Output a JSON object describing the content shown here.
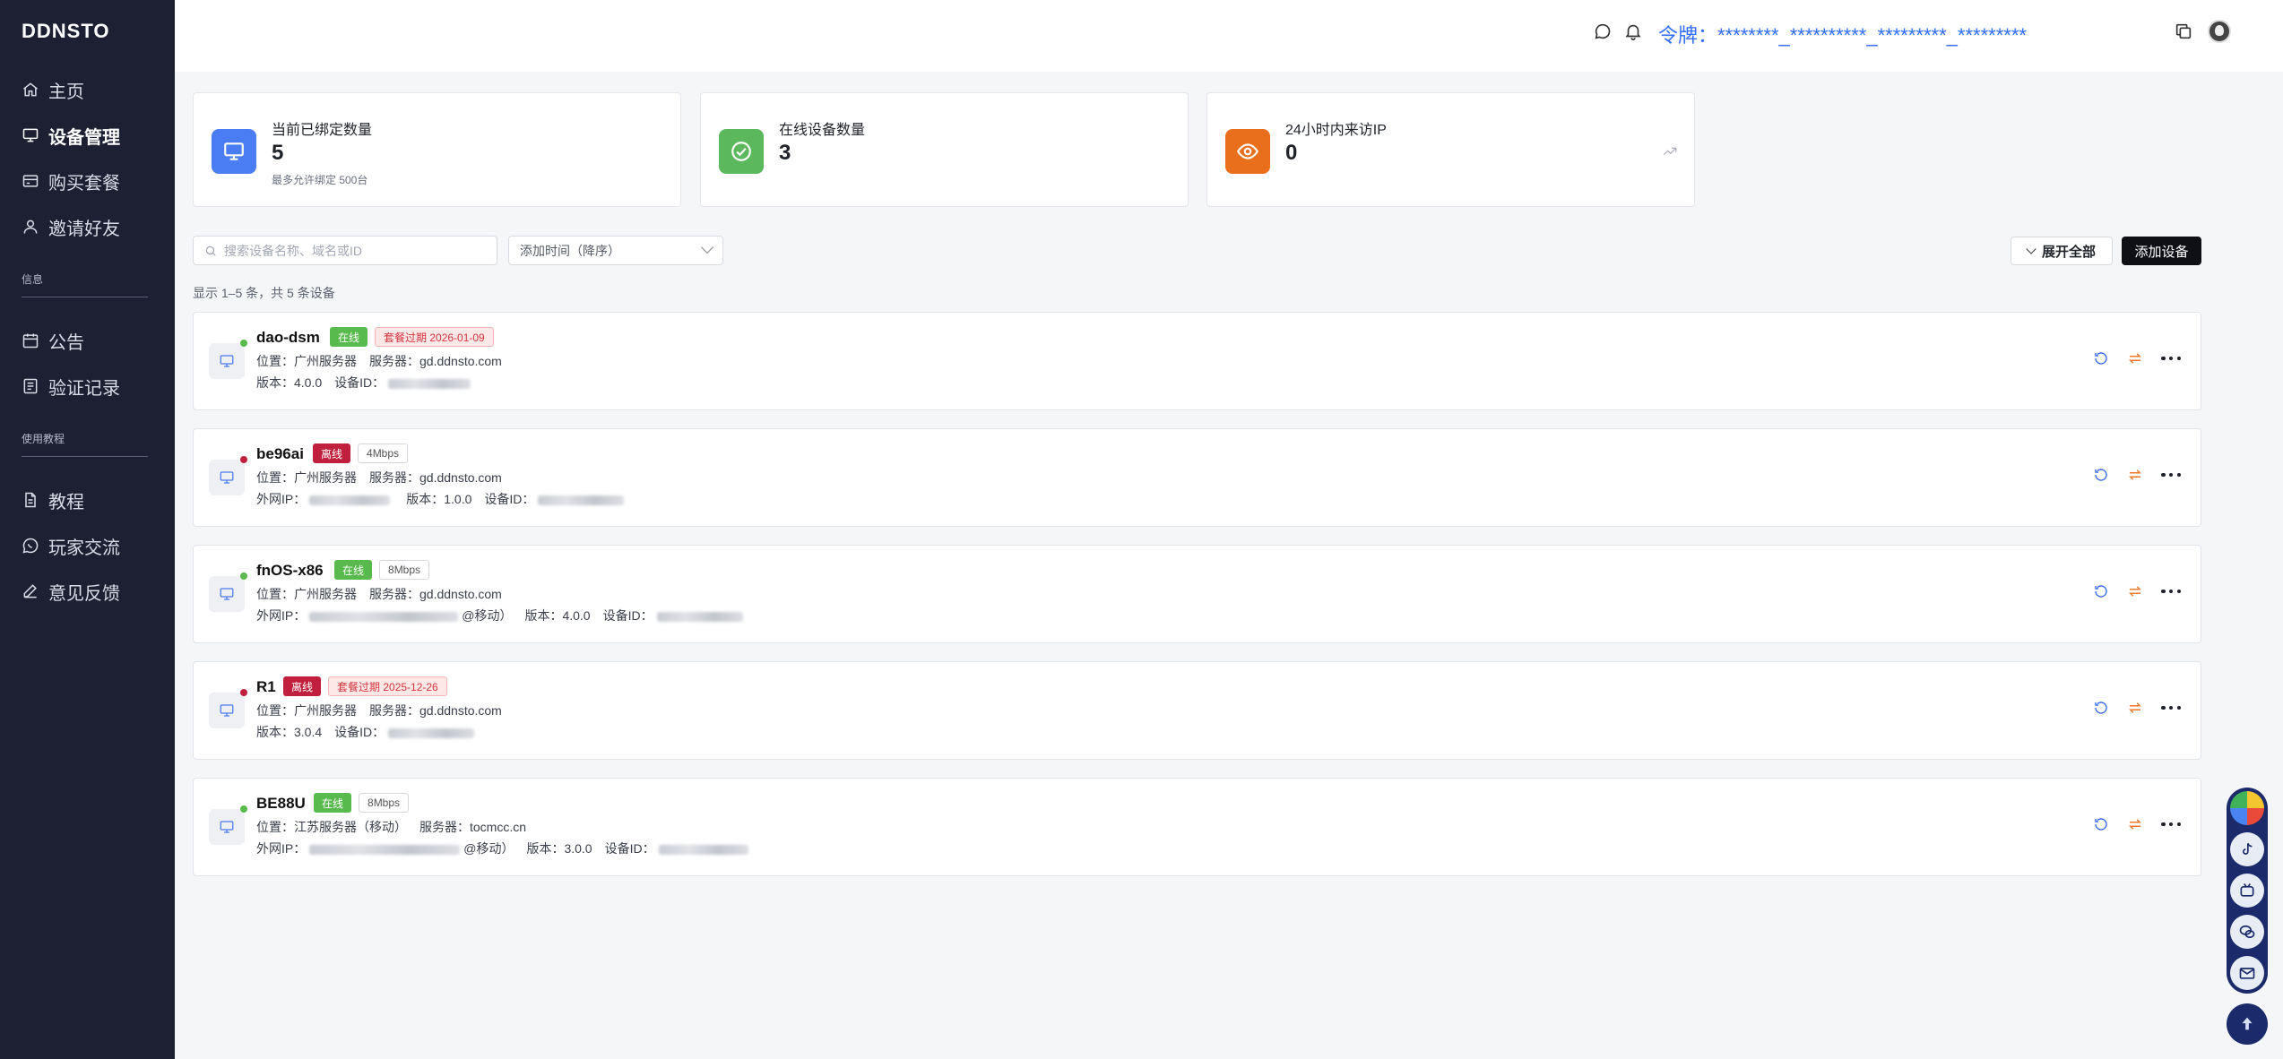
{
  "brand": "DDNSTO",
  "sidebar": {
    "items": [
      {
        "label": "主页",
        "icon": "home-icon"
      },
      {
        "label": "设备管理",
        "icon": "monitor-icon",
        "active": true
      },
      {
        "label": "购买套餐",
        "icon": "credit-card-icon"
      },
      {
        "label": "邀请好友",
        "icon": "user-icon"
      }
    ],
    "section_info": "信息",
    "info_items": [
      {
        "label": "公告",
        "icon": "calendar-icon"
      },
      {
        "label": "验证记录",
        "icon": "list-icon"
      }
    ],
    "section_tutorial": "使用教程",
    "tutorial_items": [
      {
        "label": "教程",
        "icon": "document-icon"
      },
      {
        "label": "玩家交流",
        "icon": "chat-icon"
      },
      {
        "label": "意见反馈",
        "icon": "pencil-icon"
      }
    ]
  },
  "header": {
    "token_label": "令牌：",
    "token_value": "********_**********_*********_*********"
  },
  "stats": [
    {
      "title": "当前已绑定数量",
      "value": "5",
      "sub": "最多允许绑定 500台",
      "icon": "monitor-icon",
      "color": "#4a7cf4"
    },
    {
      "title": "在线设备数量",
      "value": "3",
      "icon": "check-circle-icon",
      "color": "#5cb85c"
    },
    {
      "title": "24小时内来访IP",
      "value": "0",
      "icon": "eye-icon",
      "color": "#ea6f1c"
    }
  ],
  "toolbar": {
    "search_placeholder": "搜索设备名称、域名或ID",
    "sort_value": "添加时间（降序）",
    "expand_label": "展开全部",
    "add_label": "添加设备"
  },
  "count_text": "显示 1–5 条，共 5 条设备",
  "devices": [
    {
      "name": "dao-dsm",
      "online": true,
      "status": "在线",
      "extra_badge": "套餐过期 2026-01-09",
      "extra_type": "expired",
      "location": "位置：广州服务器",
      "server": "服务器：gd.ddnsto.com",
      "line2": [
        {
          "t": "版本：4.0.0"
        },
        {
          "t": "设备ID："
        }
      ]
    },
    {
      "name": "be96ai",
      "online": false,
      "status": "离线",
      "extra_badge": "4Mbps",
      "extra_type": "speed",
      "location": "位置：广州服务器",
      "server": "服务器：gd.ddnsto.com",
      "line2": [
        {
          "t": "外网IP："
        },
        {
          "t": "版本：1.0.0"
        },
        {
          "t": "设备ID："
        }
      ]
    },
    {
      "name": "fnOS-x86",
      "online": true,
      "status": "在线",
      "extra_badge": "8Mbps",
      "extra_type": "speed",
      "location": "位置：广州服务器",
      "server": "服务器：gd.ddnsto.com",
      "line2": [
        {
          "t": "外网IP："
        },
        {
          "t": "@移动）"
        },
        {
          "t": "版本：4.0.0"
        },
        {
          "t": "设备ID："
        }
      ]
    },
    {
      "name": "R1",
      "online": false,
      "status": "离线",
      "extra_badge": "套餐过期 2025-12-26",
      "extra_type": "expired",
      "location": "位置：广州服务器",
      "server": "服务器：gd.ddnsto.com",
      "line2": [
        {
          "t": "版本：3.0.4"
        },
        {
          "t": "设备ID："
        }
      ]
    },
    {
      "name": "BE88U",
      "online": true,
      "status": "在线",
      "extra_badge": "8Mbps",
      "extra_type": "speed",
      "location": "位置：江苏服务器（移动）",
      "server": "服务器：tocmcc.cn",
      "line2": [
        {
          "t": "外网IP："
        },
        {
          "t": "@移动）"
        },
        {
          "t": "版本：3.0.0"
        },
        {
          "t": "设备ID："
        }
      ]
    }
  ],
  "colors": {
    "sidebar_bg": "#1d2033",
    "accent_blue": "#2f6bff",
    "online_green": "#58b94c",
    "offline_red": "#c0203d",
    "action_blue": "#3b6df0",
    "action_orange": "#f07a2a"
  }
}
